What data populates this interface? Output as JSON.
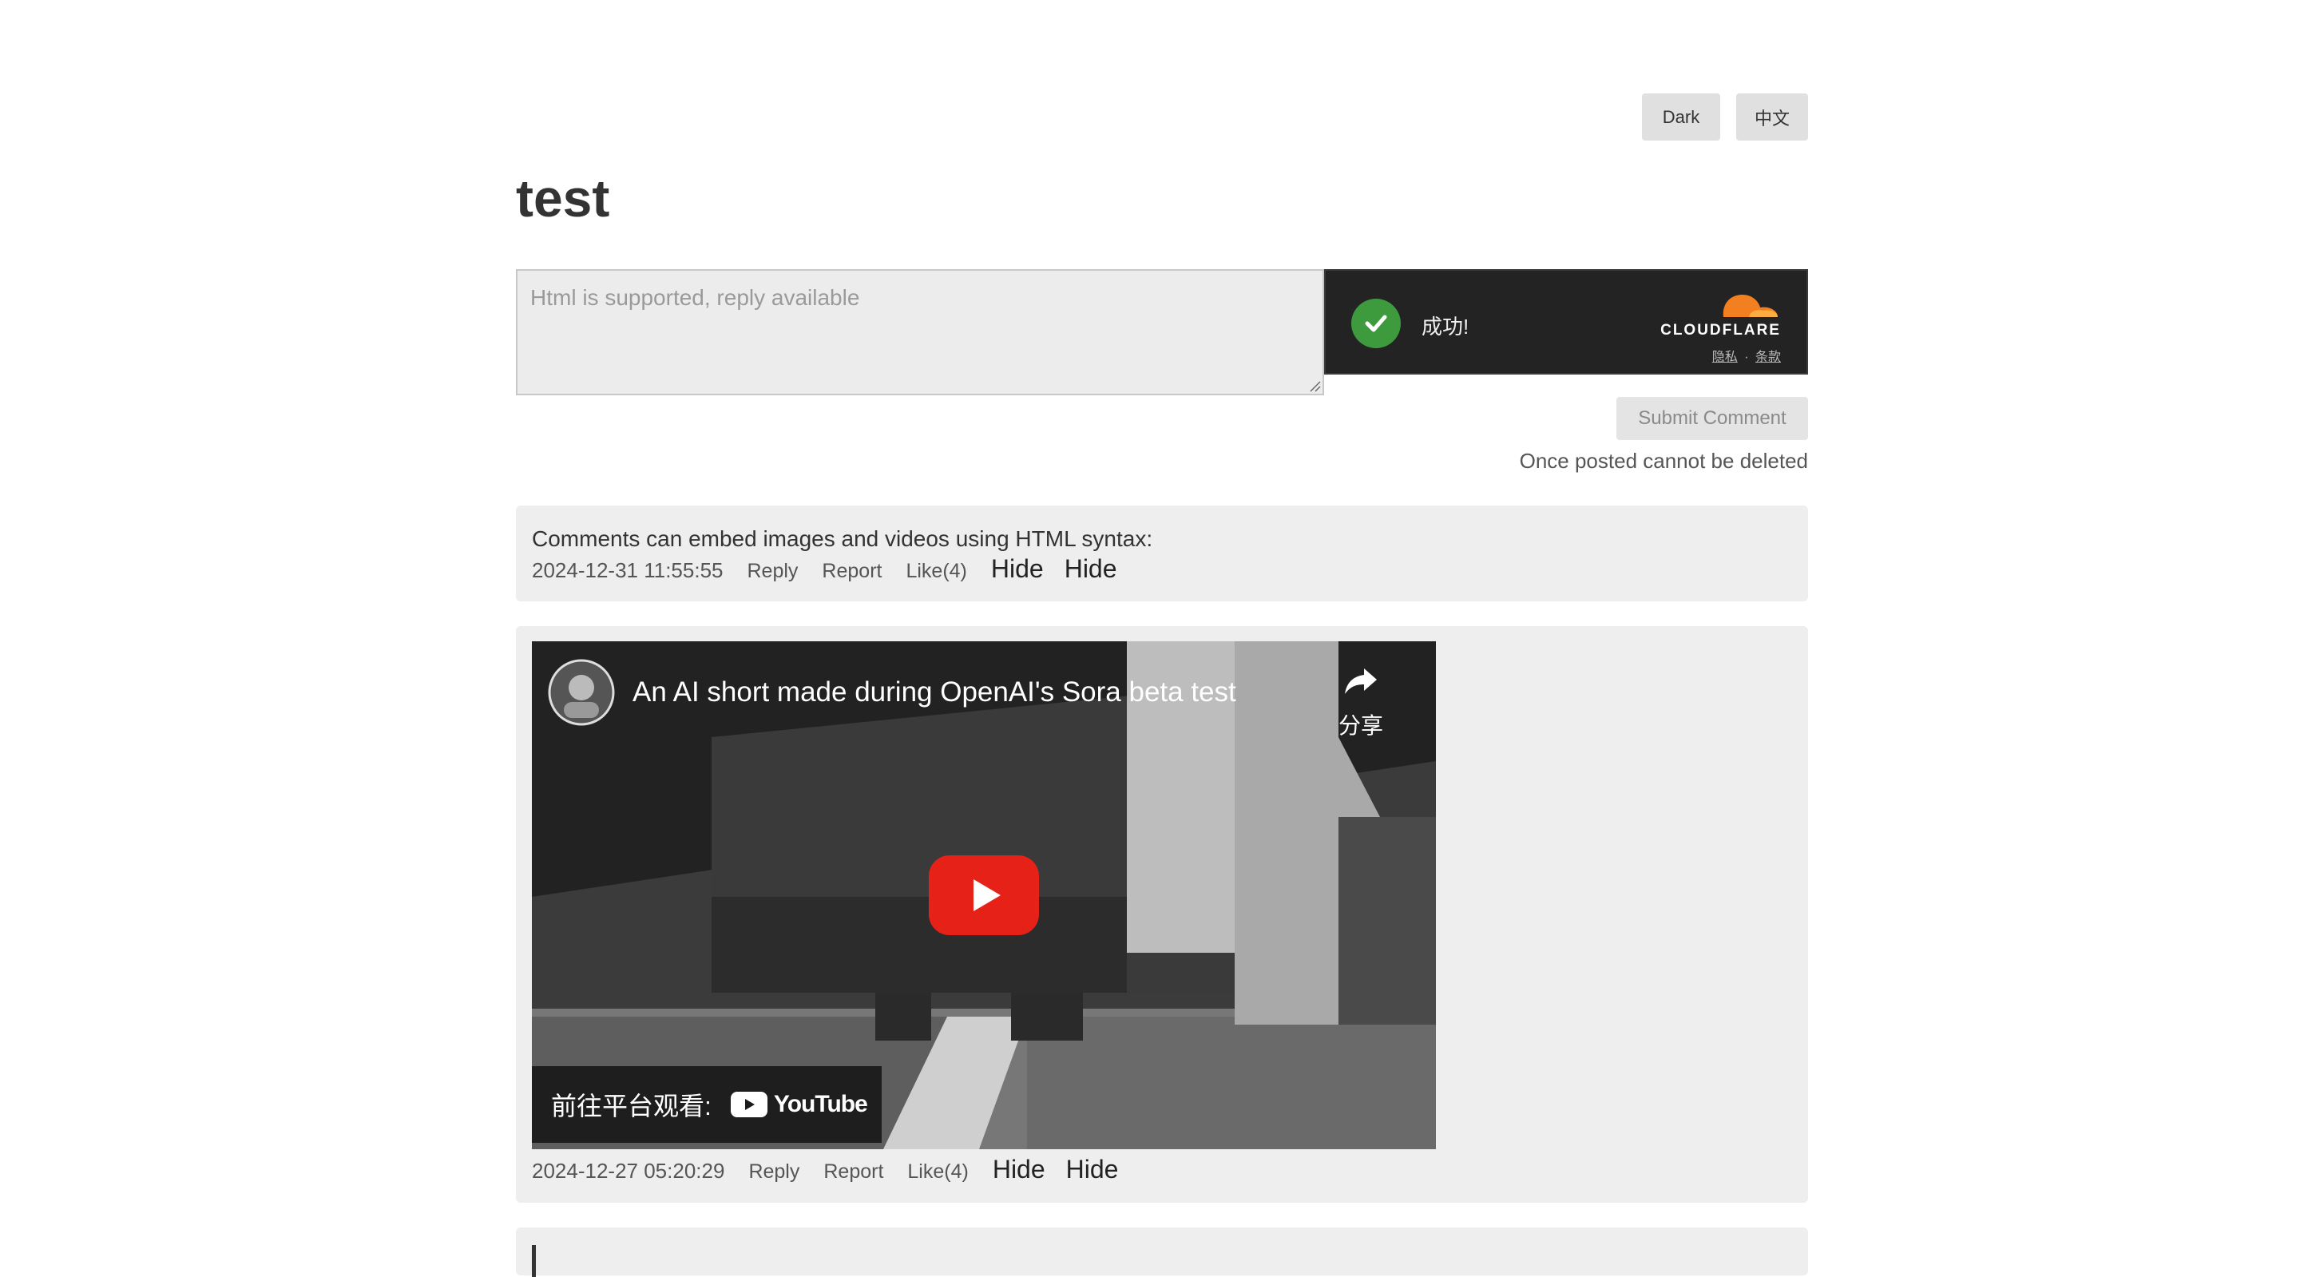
{
  "header": {
    "theme_button": "Dark",
    "language_button": "中文"
  },
  "page_title": "test",
  "composer": {
    "placeholder": "Html is supported, reply available",
    "captcha": {
      "status_text": "成功!",
      "brand": "CLOUDFLARE",
      "privacy_link": "隐私",
      "separator": "·",
      "terms_link": "条款"
    },
    "submit_label": "Submit Comment",
    "note": "Once posted cannot be deleted"
  },
  "comments": [
    {
      "text": "Comments can embed images and videos using HTML syntax:",
      "timestamp": "2024-12-31 11:55:55",
      "reply": "Reply",
      "report": "Report",
      "like": "Like(4)",
      "hide1": "Hide",
      "hide2": "Hide"
    },
    {
      "video": {
        "title": "An AI short made during OpenAI's Sora beta test",
        "share": "分享",
        "watch_on": "前往平台观看:",
        "platform": "YouTube"
      },
      "timestamp": "2024-12-27 05:20:29",
      "reply": "Reply",
      "report": "Report",
      "like": "Like(4)",
      "hide1": "Hide",
      "hide2": "Hide"
    }
  ],
  "colors": {
    "captcha_bg": "#232323",
    "check_green": "#3d9b3d",
    "cloudflare_orange": "#f38020",
    "youtube_red": "#e62117"
  },
  "icons": [
    "check-icon",
    "cloudflare-logo",
    "share-icon",
    "play-icon",
    "youtube-logo"
  ]
}
